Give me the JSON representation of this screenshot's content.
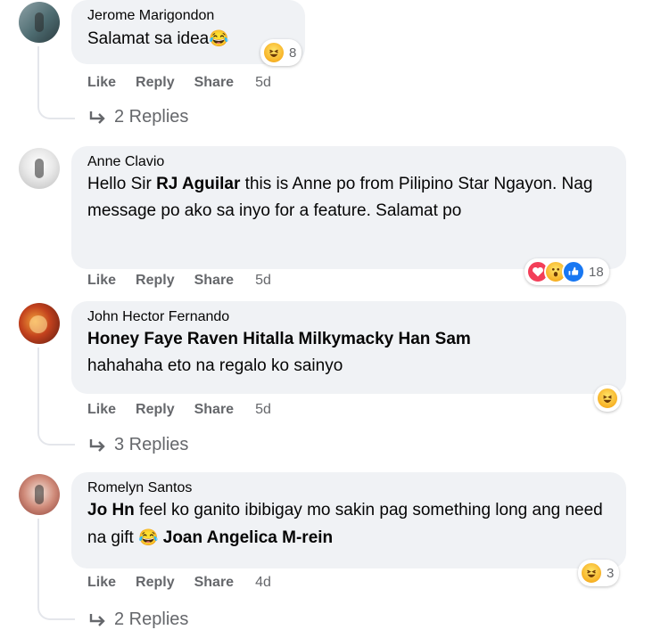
{
  "actions": {
    "like": "Like",
    "reply": "Reply",
    "share": "Share"
  },
  "comments": [
    {
      "author": "Jerome Marigondon",
      "text": "Salamat sa idea",
      "time": "5d",
      "reactions": {
        "icons": [
          "haha-icon"
        ],
        "count": "8"
      },
      "replies": "2 Replies"
    },
    {
      "author": "Anne Clavio",
      "text_pre": "Hello Sir ",
      "mention": "RJ Aguilar",
      "text_post": " this is Anne po from Pilipino Star Ngayon. Nag message po ako sa inyo for a feature. Salamat po",
      "time": "5d",
      "reactions": {
        "icons": [
          "love-icon",
          "wow-icon",
          "like-icon"
        ],
        "count": "18"
      }
    },
    {
      "author": "John Hector Fernando",
      "mention": "Honey Faye Raven Hitalla Milkymacky Han Sam",
      "text": "hahahaha eto na regalo ko sainyo",
      "time": "5d",
      "reactions": {
        "icons": [
          "haha-icon"
        ],
        "count": ""
      },
      "replies": "3 Replies"
    },
    {
      "author": "Romelyn Santos",
      "mention1": "Jo Hn",
      "text": " feel ko ganito ibibigay mo sakin pag something long ang need na gift ",
      "mention2": "Joan Angelica M-rein",
      "time": "4d",
      "reactions": {
        "icons": [
          "haha-icon"
        ],
        "count": "3"
      },
      "replies": "2 Replies"
    }
  ],
  "colors": {
    "bubble": "#f0f2f5",
    "meta": "#65676b",
    "haha": "#f7b125",
    "love": "#f33e58",
    "like": "#1877f2"
  }
}
